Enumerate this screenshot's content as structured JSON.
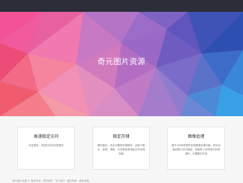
{
  "hero": {
    "title": "奇元图片资源"
  },
  "features": [
    {
      "title": "高速稳定访问",
      "description": "安全稳定、低延时访问优质服务"
    },
    {
      "title": "稳定存储",
      "description": "硬件稳定、安全可靠的存储服务，适用于图片、音视、视频、文本等各类海量文件存储场景"
    },
    {
      "title": "图像处理",
      "description": "基于API请求提供多种图像处理功能，即可对指定图片进行缩放、剪裁等十余种常见处理操作，无需额外开发"
    }
  ],
  "footer": {
    "text": "奇元图片资源 © 版权所有 · 联系我们 · 关于我们 · 服务条款 · 隐私政策"
  }
}
